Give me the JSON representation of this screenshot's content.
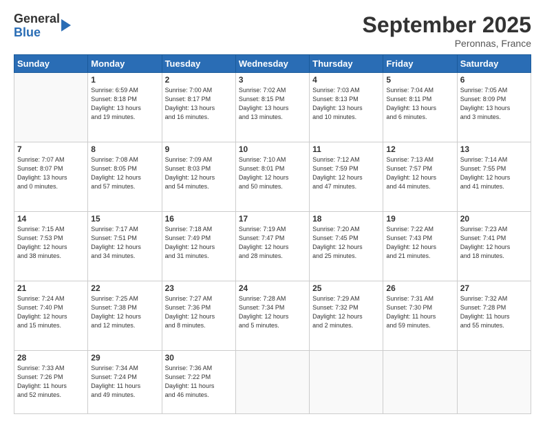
{
  "logo": {
    "general": "General",
    "blue": "Blue"
  },
  "title": "September 2025",
  "subtitle": "Peronnas, France",
  "days_header": [
    "Sunday",
    "Monday",
    "Tuesday",
    "Wednesday",
    "Thursday",
    "Friday",
    "Saturday"
  ],
  "weeks": [
    [
      {
        "day": "",
        "info": ""
      },
      {
        "day": "1",
        "info": "Sunrise: 6:59 AM\nSunset: 8:18 PM\nDaylight: 13 hours\nand 19 minutes."
      },
      {
        "day": "2",
        "info": "Sunrise: 7:00 AM\nSunset: 8:17 PM\nDaylight: 13 hours\nand 16 minutes."
      },
      {
        "day": "3",
        "info": "Sunrise: 7:02 AM\nSunset: 8:15 PM\nDaylight: 13 hours\nand 13 minutes."
      },
      {
        "day": "4",
        "info": "Sunrise: 7:03 AM\nSunset: 8:13 PM\nDaylight: 13 hours\nand 10 minutes."
      },
      {
        "day": "5",
        "info": "Sunrise: 7:04 AM\nSunset: 8:11 PM\nDaylight: 13 hours\nand 6 minutes."
      },
      {
        "day": "6",
        "info": "Sunrise: 7:05 AM\nSunset: 8:09 PM\nDaylight: 13 hours\nand 3 minutes."
      }
    ],
    [
      {
        "day": "7",
        "info": "Sunrise: 7:07 AM\nSunset: 8:07 PM\nDaylight: 13 hours\nand 0 minutes."
      },
      {
        "day": "8",
        "info": "Sunrise: 7:08 AM\nSunset: 8:05 PM\nDaylight: 12 hours\nand 57 minutes."
      },
      {
        "day": "9",
        "info": "Sunrise: 7:09 AM\nSunset: 8:03 PM\nDaylight: 12 hours\nand 54 minutes."
      },
      {
        "day": "10",
        "info": "Sunrise: 7:10 AM\nSunset: 8:01 PM\nDaylight: 12 hours\nand 50 minutes."
      },
      {
        "day": "11",
        "info": "Sunrise: 7:12 AM\nSunset: 7:59 PM\nDaylight: 12 hours\nand 47 minutes."
      },
      {
        "day": "12",
        "info": "Sunrise: 7:13 AM\nSunset: 7:57 PM\nDaylight: 12 hours\nand 44 minutes."
      },
      {
        "day": "13",
        "info": "Sunrise: 7:14 AM\nSunset: 7:55 PM\nDaylight: 12 hours\nand 41 minutes."
      }
    ],
    [
      {
        "day": "14",
        "info": "Sunrise: 7:15 AM\nSunset: 7:53 PM\nDaylight: 12 hours\nand 38 minutes."
      },
      {
        "day": "15",
        "info": "Sunrise: 7:17 AM\nSunset: 7:51 PM\nDaylight: 12 hours\nand 34 minutes."
      },
      {
        "day": "16",
        "info": "Sunrise: 7:18 AM\nSunset: 7:49 PM\nDaylight: 12 hours\nand 31 minutes."
      },
      {
        "day": "17",
        "info": "Sunrise: 7:19 AM\nSunset: 7:47 PM\nDaylight: 12 hours\nand 28 minutes."
      },
      {
        "day": "18",
        "info": "Sunrise: 7:20 AM\nSunset: 7:45 PM\nDaylight: 12 hours\nand 25 minutes."
      },
      {
        "day": "19",
        "info": "Sunrise: 7:22 AM\nSunset: 7:43 PM\nDaylight: 12 hours\nand 21 minutes."
      },
      {
        "day": "20",
        "info": "Sunrise: 7:23 AM\nSunset: 7:41 PM\nDaylight: 12 hours\nand 18 minutes."
      }
    ],
    [
      {
        "day": "21",
        "info": "Sunrise: 7:24 AM\nSunset: 7:40 PM\nDaylight: 12 hours\nand 15 minutes."
      },
      {
        "day": "22",
        "info": "Sunrise: 7:25 AM\nSunset: 7:38 PM\nDaylight: 12 hours\nand 12 minutes."
      },
      {
        "day": "23",
        "info": "Sunrise: 7:27 AM\nSunset: 7:36 PM\nDaylight: 12 hours\nand 8 minutes."
      },
      {
        "day": "24",
        "info": "Sunrise: 7:28 AM\nSunset: 7:34 PM\nDaylight: 12 hours\nand 5 minutes."
      },
      {
        "day": "25",
        "info": "Sunrise: 7:29 AM\nSunset: 7:32 PM\nDaylight: 12 hours\nand 2 minutes."
      },
      {
        "day": "26",
        "info": "Sunrise: 7:31 AM\nSunset: 7:30 PM\nDaylight: 11 hours\nand 59 minutes."
      },
      {
        "day": "27",
        "info": "Sunrise: 7:32 AM\nSunset: 7:28 PM\nDaylight: 11 hours\nand 55 minutes."
      }
    ],
    [
      {
        "day": "28",
        "info": "Sunrise: 7:33 AM\nSunset: 7:26 PM\nDaylight: 11 hours\nand 52 minutes."
      },
      {
        "day": "29",
        "info": "Sunrise: 7:34 AM\nSunset: 7:24 PM\nDaylight: 11 hours\nand 49 minutes."
      },
      {
        "day": "30",
        "info": "Sunrise: 7:36 AM\nSunset: 7:22 PM\nDaylight: 11 hours\nand 46 minutes."
      },
      {
        "day": "",
        "info": ""
      },
      {
        "day": "",
        "info": ""
      },
      {
        "day": "",
        "info": ""
      },
      {
        "day": "",
        "info": ""
      }
    ]
  ]
}
